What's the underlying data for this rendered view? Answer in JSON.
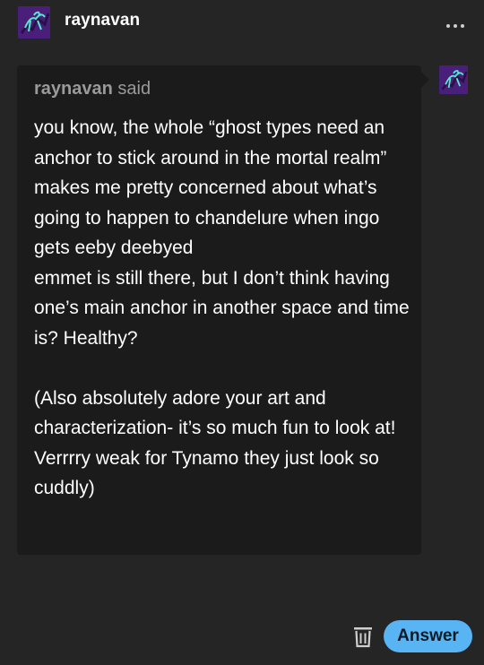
{
  "header": {
    "username": "raynavan",
    "avatar_icon": "purple-creature-avatar-icon",
    "more_icon": "ellipsis-icon"
  },
  "question": {
    "asker_name": "raynavan",
    "asker_said": "said",
    "paragraphs": [
      "you know, the whole “ghost types need an anchor to stick around in the mortal realm” makes me pretty concerned about what’s going to happen to chandelure when ingo gets eeby deebyed",
      "emmet is still there, but I don’t think having one’s main anchor in another space and time is? Healthy?",
      "",
      "(Also absolutely adore your art and characterization- it’s so much fun to look at! Verrrry weak for Tynamo they just look so cuddly)"
    ]
  },
  "actions": {
    "trash_icon": "trash-icon",
    "answer_label": "Answer",
    "answer_color": "#58b4f3"
  },
  "colors": {
    "background": "#252525",
    "bubble": "#1b1b1b",
    "muted_text": "#9a9a9a"
  }
}
